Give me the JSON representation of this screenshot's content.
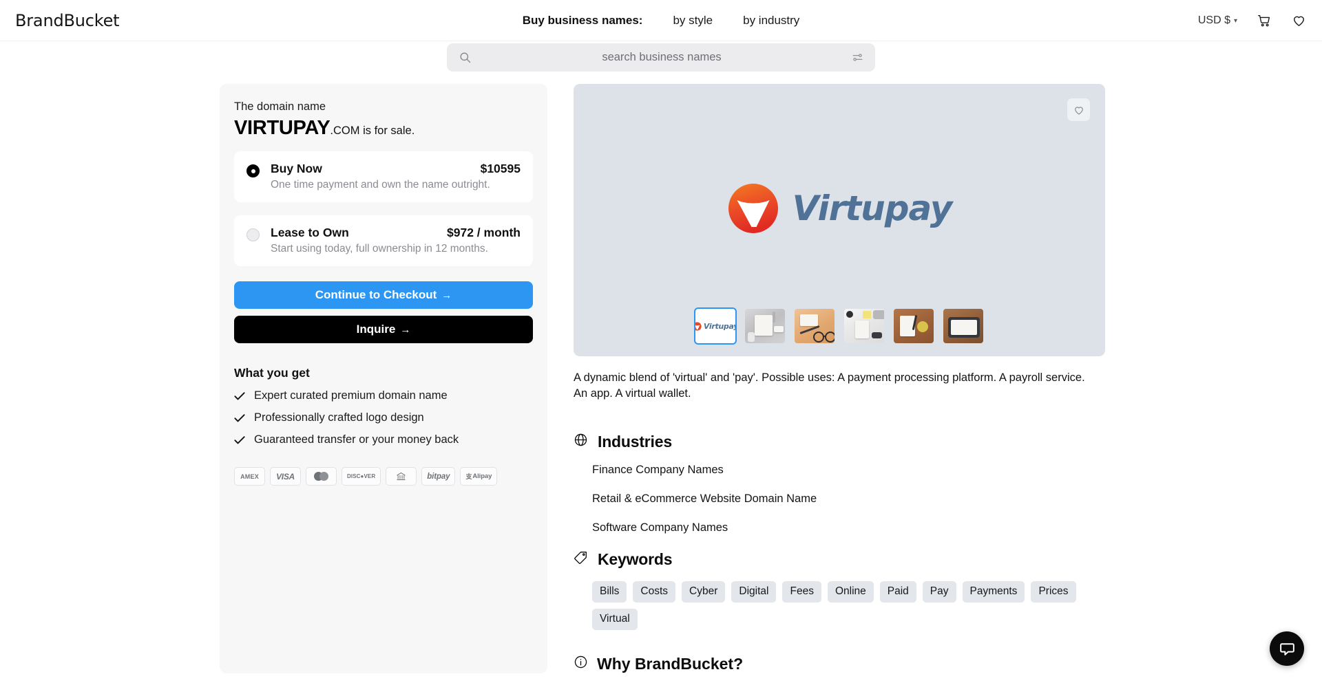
{
  "header": {
    "logo": "BrandBucket",
    "nav_label": "Buy business names:",
    "nav_links": [
      {
        "label": "by style"
      },
      {
        "label": "by industry"
      }
    ],
    "currency": "USD $",
    "currency_chevron": "▾",
    "cart_icon": "cart-icon",
    "wishlist_icon": "heart-icon"
  },
  "search": {
    "placeholder": "search business names",
    "value": "",
    "search_icon": "search-icon",
    "filter_icon": "filter-sliders-icon"
  },
  "buy_card": {
    "domain_label": "The domain name",
    "domain_name": "VIRTUPAY",
    "domain_rest": ".COM is for sale.",
    "options": [
      {
        "title": "Buy Now",
        "price": "$10595",
        "subtitle": "One time payment and own the name outright.",
        "selected": true
      },
      {
        "title": "Lease to Own",
        "price": "$972 / month",
        "subtitle": "Start using today, full ownership in 12 months.",
        "selected": false
      }
    ],
    "checkout_button": "Continue to Checkout",
    "inquire_button": "Inquire",
    "arrow_glyph": "→",
    "what_you_get_title": "What you get",
    "what_you_get": [
      "Expert curated premium domain name",
      "Professionally crafted logo design",
      "Guaranteed transfer or your money back"
    ],
    "payment_methods": [
      {
        "name": "amex",
        "label": "AMEX"
      },
      {
        "name": "visa",
        "label": "VISA"
      },
      {
        "name": "mastercard",
        "label": ""
      },
      {
        "name": "discover",
        "label": "DISC●VER"
      },
      {
        "name": "bank",
        "label": ""
      },
      {
        "name": "bitpay",
        "label": "bitpay"
      },
      {
        "name": "alipay",
        "label": "Alipay"
      }
    ]
  },
  "preview": {
    "brand_text": "Virtupay",
    "logo_mark_color": "#e8472a",
    "logo_mark_color2": "#f47b20",
    "brand_text_color": "#4f7296",
    "background_color": "#dce2e8",
    "favorite_icon": "heart-icon",
    "thumbnails": [
      {
        "name": "thumb-logo",
        "type": "logo",
        "selected": true
      },
      {
        "name": "thumb-mockup-1",
        "type": "photo",
        "selected": false
      },
      {
        "name": "thumb-mockup-2",
        "type": "photo",
        "selected": false
      },
      {
        "name": "thumb-mockup-3",
        "type": "photo",
        "selected": false
      },
      {
        "name": "thumb-mockup-4",
        "type": "photo",
        "selected": false
      },
      {
        "name": "thumb-mockup-5",
        "type": "photo",
        "selected": false
      }
    ]
  },
  "description": "A dynamic blend of 'virtual' and 'pay'. Possible uses: A payment processing platform. A payroll service. An app. A virtual wallet.",
  "industries": {
    "title": "Industries",
    "icon": "globe-icon",
    "items": [
      "Finance Company Names",
      "Retail & eCommerce Website Domain Name",
      "Software Company Names"
    ]
  },
  "keywords": {
    "title": "Keywords",
    "icon": "tag-icon",
    "items": [
      "Bills",
      "Costs",
      "Cyber",
      "Digital",
      "Fees",
      "Online",
      "Paid",
      "Pay",
      "Payments",
      "Prices",
      "Virtual"
    ]
  },
  "why": {
    "title": "Why BrandBucket?",
    "icon": "info-icon"
  },
  "chat": {
    "icon": "chat-bubble-icon",
    "color": "#0b0b0b"
  },
  "theme": {
    "accent_blue": "#2c96f2",
    "dark": "#000000",
    "card_bg": "#f7f7f8",
    "tag_bg": "#e3e6ea"
  }
}
